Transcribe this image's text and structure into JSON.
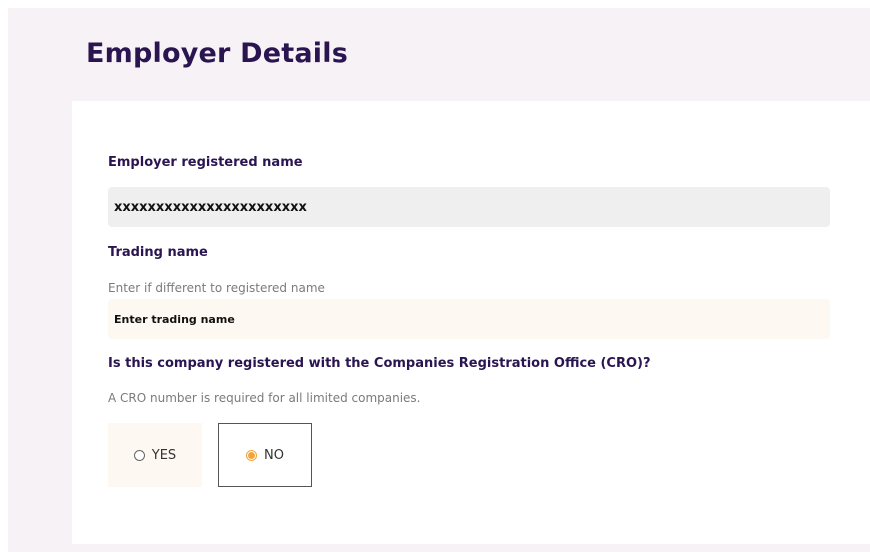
{
  "page": {
    "title": "Employer Details"
  },
  "form": {
    "registered_name": {
      "label": "Employer registered name",
      "value": "xxxxxxxxxxxxxxxxxxxxxxx"
    },
    "trading_name": {
      "label": "Trading name",
      "hint": "Enter if different to registered name",
      "placeholder": "Enter trading name"
    },
    "cro": {
      "question": "Is this company registered with the Companies Registration Office (CRO)?",
      "hint": "A CRO number is required for all limited companies.",
      "options": [
        {
          "label": "YES",
          "selected": false
        },
        {
          "label": "NO",
          "selected": true
        }
      ]
    }
  },
  "colors": {
    "heading": "#2a1550",
    "accent": "#f2a43a",
    "page_background": "#f6f2f6",
    "input_background": "#fef8f2",
    "readonly_background": "#efefef"
  }
}
